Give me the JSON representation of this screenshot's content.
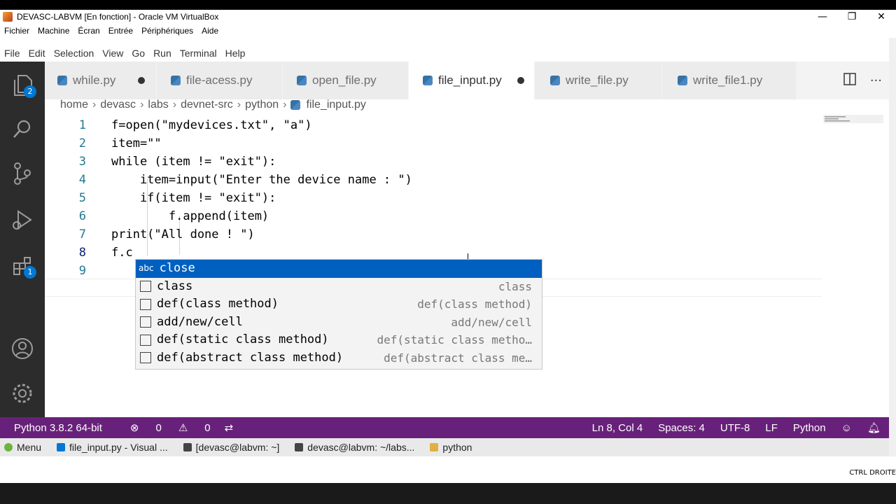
{
  "window": {
    "title": "DEVASC-LABVM [En fonction] - Oracle VM VirtualBox",
    "menu": [
      "Fichier",
      "Machine",
      "Écran",
      "Entrée",
      "Périphériques",
      "Aide"
    ]
  },
  "vscode": {
    "menu": [
      "File",
      "Edit",
      "Selection",
      "View",
      "Go",
      "Run",
      "Terminal",
      "Help"
    ],
    "activity_badges": {
      "explorer": "2",
      "extensions": "1"
    },
    "tabs": [
      {
        "label": "while.py",
        "dirty": true,
        "active": false
      },
      {
        "label": "file-acess.py",
        "dirty": false,
        "active": false
      },
      {
        "label": "open_file.py",
        "dirty": false,
        "active": false
      },
      {
        "label": "file_input.py",
        "dirty": true,
        "active": true
      },
      {
        "label": "write_file.py",
        "dirty": false,
        "active": false
      },
      {
        "label": "write_file1.py",
        "dirty": false,
        "active": false
      }
    ],
    "breadcrumb": [
      "home",
      "devasc",
      "labs",
      "devnet-src",
      "python",
      "file_input.py"
    ],
    "code_lines": [
      "f=open(\"mydevices.txt\", \"a\")",
      "item=\"\"",
      "while (item != \"exit\"):",
      "    item=input(\"Enter the device name : \")",
      "    if(item != \"exit\"):",
      "        f.append(item)",
      "print(\"All done ! \")",
      "f.c",
      ""
    ],
    "line_numbers": [
      "1",
      "2",
      "3",
      "4",
      "5",
      "6",
      "7",
      "8",
      "9"
    ],
    "suggestions": [
      {
        "label": "close",
        "detail": "",
        "kind": "abc",
        "selected": true
      },
      {
        "label": "class",
        "detail": "class",
        "kind": "snippet",
        "selected": false
      },
      {
        "label": "def(class method)",
        "detail": "def(class method)",
        "kind": "snippet",
        "selected": false
      },
      {
        "label": "add/new/cell",
        "detail": "add/new/cell",
        "kind": "snippet",
        "selected": false
      },
      {
        "label": "def(static class method)",
        "detail": "def(static class metho…",
        "kind": "snippet",
        "selected": false
      },
      {
        "label": "def(abstract class method)",
        "detail": "def(abstract class me…",
        "kind": "snippet",
        "selected": false
      }
    ],
    "suggest_kind_abc": "abc",
    "status": {
      "interpreter": "Python 3.8.2 64-bit",
      "errors": "0",
      "warnings": "0",
      "position": "Ln 8, Col 4",
      "spaces": "Spaces: 4",
      "encoding": "UTF-8",
      "eol": "LF",
      "language": "Python"
    },
    "accent": "#68217a"
  },
  "taskbar": {
    "items": [
      "Menu",
      "file_input.py - Visual ...",
      "[devasc@labvm: ~]",
      "devasc@labvm: ~/labs...",
      "python"
    ]
  },
  "host": {
    "hotkey": "CTRL DROITE"
  }
}
